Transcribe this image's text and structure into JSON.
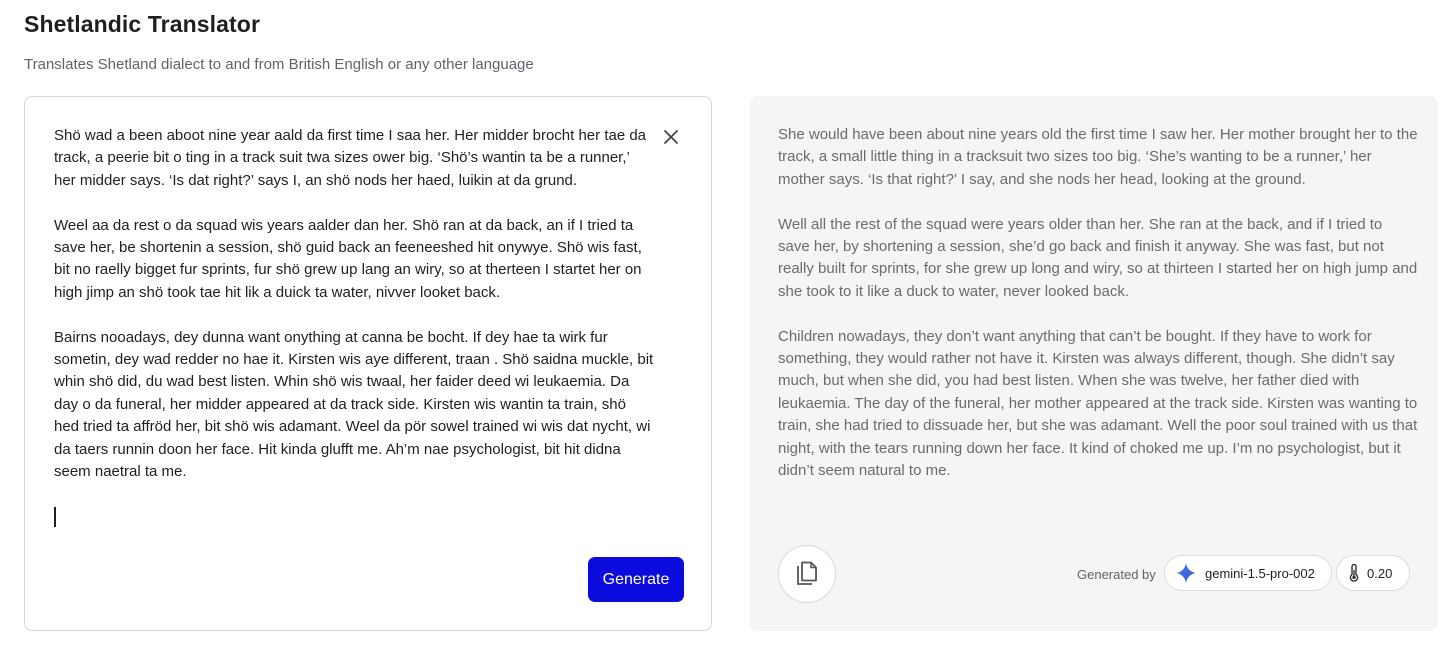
{
  "header": {
    "title": "Shetlandic Translator",
    "subtitle": "Translates Shetland dialect to and from British English or any other language"
  },
  "input": {
    "text": "Shö wad a been aboot nine year aald da first time I saa her. Her midder brocht her tae da track, a peerie bit o ting in a track suit twa sizes ower big. ‘Shö’s wantin ta be a runner,’ her midder says. ‘Is dat right?’ says I, an shö nods her haed, luikin at da grund.\n\nWeel aa da rest o da squad wis years aalder dan her. Shö ran at da back, an if I tried ta save her, be shortenin a session, shö guid back an feeneeshed hit onywye. Shö wis fast, bit no raelly bigget fur sprints, fur shö grew up lang an wiry, so at therteen I startet her on high jimp an shö took tae hit lik a duick ta water, nivver looket back.\n\nBairns nooadays, dey dunna want onything at canna be bocht. If dey hae ta wirk fur sometin, dey wad redder no hae it. Kirsten wis aye different, traan . Shö saidna muckle, bit whin shö did, du wad best listen. Whin shö wis twaal, her faider deed wi leukaemia. Da day o da funeral, her midder appeared at da track side. Kirsten wis wantin ta train, shö hed tried ta affröd her, bit shö wis adamant. Weel da pör sowel trained wi wis dat nycht, wi da taers runnin doon her face. Hit kinda glufft me. Ah’m nae psychologist, bit hit didna seem naetral ta me.",
    "clear_icon": "close-icon",
    "generate_label": "Generate",
    "generate_color": "#0b0bde"
  },
  "output": {
    "text": "She would have been about nine years old the first time I saw her. Her mother brought her to the track, a small little thing in a tracksuit two sizes too big. ‘She’s wanting to be a runner,’ her mother says. ‘Is that right?’ I say, and she nods her head, looking at the ground.\n\nWell all the rest of the squad were years older than her. She ran at the back, and if I tried to save her, by shortening a session, she’d go back and finish it anyway. She was fast, but not really built for sprints, for she grew up long and wiry, so at thirteen I started her on high jump and she took to it like a duck to water, never looked back.\n\nChildren nowadays, they don’t want anything that can’t be bought. If they have to work for something, they would rather not have it. Kirsten was always different, though. She didn’t say much, but when she did, you had best listen. When she was twelve, her father died with leukaemia. The day of the funeral, her mother appeared at the track side. Kirsten was wanting to train, she had tried to dissuade her, but she was adamant. Well the poor soul trained with us that night, with the tears running down her face. It kind of choked me up. I’m no psychologist, but it didn’t seem natural to me.",
    "copy_icon": "copy-icon",
    "generated_by_label": "Generated by",
    "model_name": "gemini-1.5-pro-002",
    "model_icon": "gemini-sparkle-icon",
    "temperature": "0.20",
    "temperature_icon": "thermometer-icon"
  }
}
